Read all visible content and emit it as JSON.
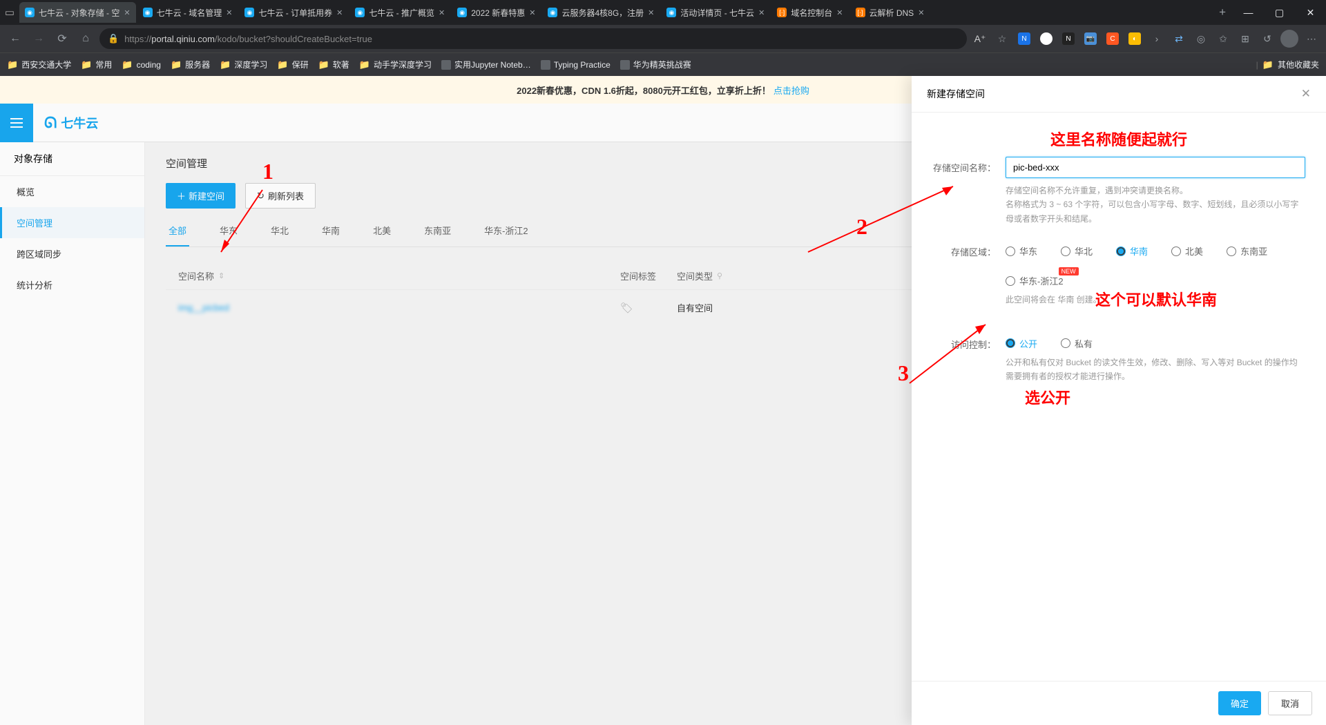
{
  "browser": {
    "tabs": [
      {
        "title": "七牛云 - 对象存储 - 空",
        "active": true,
        "icon": "blue"
      },
      {
        "title": "七牛云 - 域名管理",
        "icon": "blue"
      },
      {
        "title": "七牛云 - 订单抵用券",
        "icon": "blue"
      },
      {
        "title": "七牛云 - 推广概览",
        "icon": "blue"
      },
      {
        "title": "2022 新春特惠",
        "icon": "blue"
      },
      {
        "title": "云服务器4核8G，注册",
        "icon": "blue"
      },
      {
        "title": "活动详情页 - 七牛云",
        "icon": "blue"
      },
      {
        "title": "域名控制台",
        "icon": "orange"
      },
      {
        "title": "云解析 DNS",
        "icon": "orange"
      }
    ],
    "url_prefix": "https://",
    "url_host": "portal.qiniu.com",
    "url_path": "/kodo/bucket?shouldCreateBucket=true"
  },
  "bookmarks": {
    "items": [
      "西安交通大学",
      "常用",
      "coding",
      "服务器",
      "深度学习",
      "保研",
      "软著",
      "动手学深度学习",
      "实用Jupyter Noteb…",
      "Typing Practice",
      "华为精英挑战赛"
    ],
    "right": "其他收藏夹"
  },
  "banner": {
    "text1": "2022新春优惠，CDN 1.6折起，8080元开工红包，立享折上折！",
    "link": "点击抢购"
  },
  "logo": "七牛云",
  "sidebar": {
    "title": "对象存储",
    "items": [
      {
        "label": "概览"
      },
      {
        "label": "空间管理",
        "active": true
      },
      {
        "label": "跨区域同步"
      },
      {
        "label": "统计分析"
      }
    ]
  },
  "main": {
    "title": "空间管理",
    "btn_create": "新建空间",
    "btn_refresh": "刷新列表",
    "tabs": [
      {
        "label": "全部",
        "active": true
      },
      {
        "label": "华东"
      },
      {
        "label": "华北"
      },
      {
        "label": "华南"
      },
      {
        "label": "北美"
      },
      {
        "label": "东南亚"
      },
      {
        "label": "华东-浙江2"
      }
    ],
    "table": {
      "col_name": "空间名称",
      "col_tag": "空间标签",
      "col_type": "空间类型",
      "row1_name": "img__picbed",
      "row1_type": "自有空间"
    }
  },
  "drawer": {
    "title": "新建存储空间",
    "label_name": "存储空间名称：",
    "input_value": "pic-bed-xxx",
    "help_name": "存储空间名称不允许重复，遇到冲突请更换名称。\n名称格式为 3 ~ 63 个字符，可以包含小写字母、数字、短划线，且必须以小写字母或者数字开头和结尾。",
    "label_region": "存储区域：",
    "regions": [
      {
        "label": "华东"
      },
      {
        "label": "华北"
      },
      {
        "label": "华南",
        "checked": true
      },
      {
        "label": "北美"
      },
      {
        "label": "东南亚"
      },
      {
        "label": "华东-浙江2",
        "new": true
      }
    ],
    "help_region": "此空间将会在 华南 创建。",
    "label_access": "访问控制：",
    "access": [
      {
        "label": "公开",
        "checked": true
      },
      {
        "label": "私有"
      }
    ],
    "help_access": "公开和私有仅对 Bucket 的读文件生效，修改、删除、写入等对 Bucket 的操作均需要拥有者的授权才能进行操作。",
    "btn_ok": "确定",
    "btn_cancel": "取消"
  },
  "annotations": {
    "n1": "1",
    "n2": "2",
    "n3": "3",
    "t1": "这里名称随便起就行",
    "t2": "这个可以默认华南",
    "t3": "选公开"
  }
}
